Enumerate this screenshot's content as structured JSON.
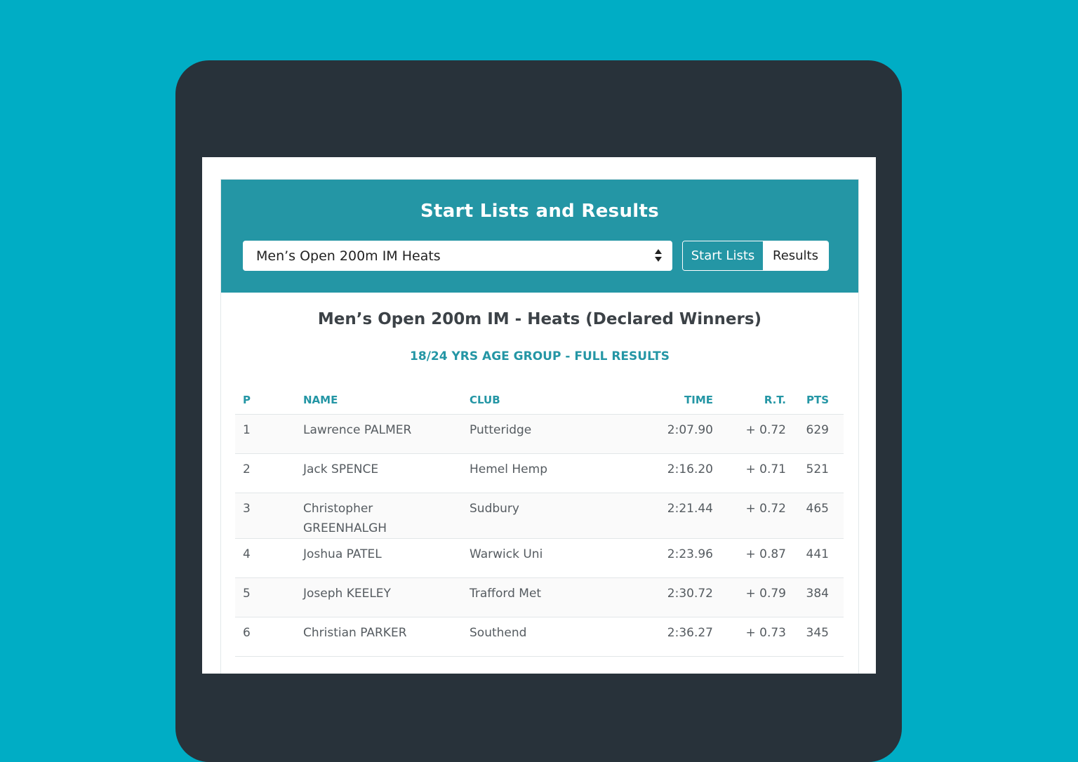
{
  "header": {
    "title": "Start Lists and Results",
    "event_select": "Men’s Open 200m IM Heats",
    "toggle": {
      "start_lists": "Start Lists",
      "results": "Results"
    }
  },
  "results": {
    "title": "Men’s Open 200m IM - Heats (Declared Winners)",
    "subtitle": "18/24 YRS AGE GROUP - FULL RESULTS",
    "columns": {
      "p": "P",
      "name": "NAME",
      "club": "CLUB",
      "time": "TIME",
      "rt": "R.T.",
      "pts": "PTS"
    },
    "rows": [
      {
        "p": "1",
        "name": "Lawrence PALMER",
        "club": "Putteridge",
        "time": "2:07.90",
        "rt": "+ 0.72",
        "pts": "629"
      },
      {
        "p": "2",
        "name": "Jack SPENCE",
        "club": "Hemel Hemp",
        "time": "2:16.20",
        "rt": "+ 0.71",
        "pts": "521"
      },
      {
        "p": "3",
        "name": "Christopher GREENHALGH",
        "club": "Sudbury",
        "time": "2:21.44",
        "rt": "+ 0.72",
        "pts": "465"
      },
      {
        "p": "4",
        "name": "Joshua PATEL",
        "club": "Warwick Uni",
        "time": "2:23.96",
        "rt": "+ 0.87",
        "pts": "441"
      },
      {
        "p": "5",
        "name": "Joseph KEELEY",
        "club": "Trafford Met",
        "time": "2:30.72",
        "rt": "+ 0.79",
        "pts": "384"
      },
      {
        "p": "6",
        "name": "Christian PARKER",
        "club": "Southend",
        "time": "2:36.27",
        "rt": "+ 0.73",
        "pts": "345"
      }
    ]
  },
  "colors": {
    "background": "#00adc5",
    "device": "#28323a",
    "accent": "#2496a5"
  },
  "icons": {
    "select": "select-updown-arrows-icon"
  }
}
